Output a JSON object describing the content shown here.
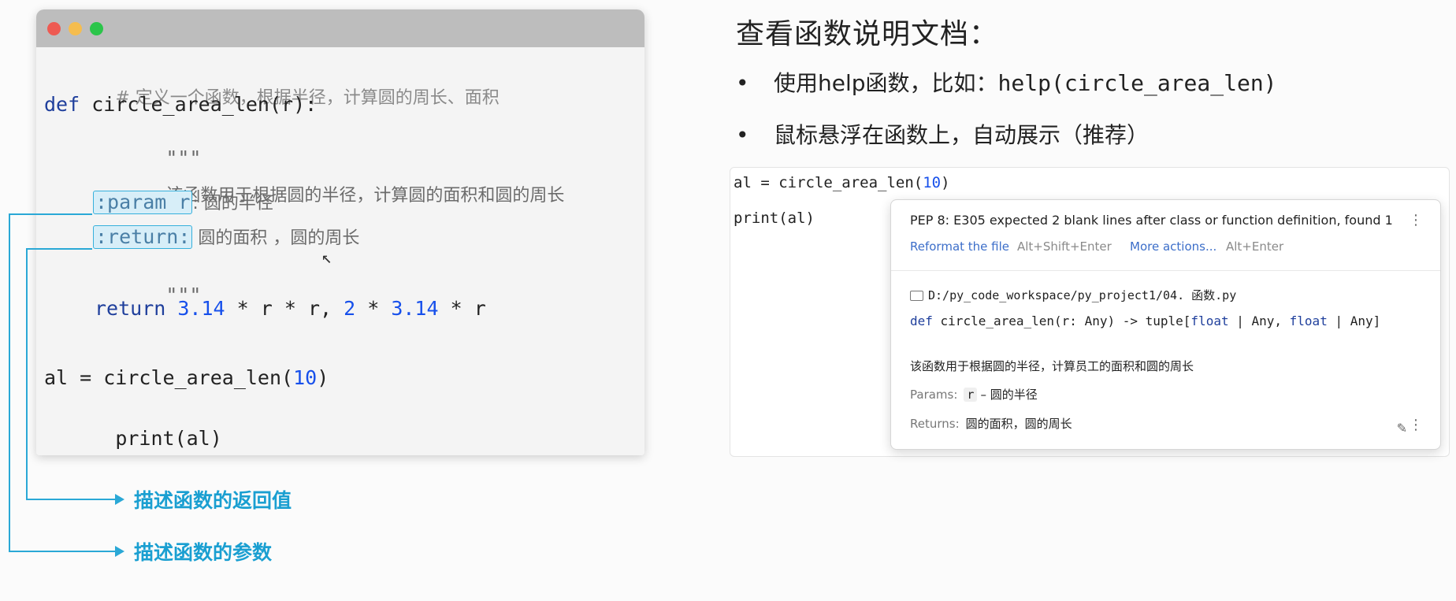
{
  "colors": {
    "mac_red": "#ee5a52",
    "mac_yellow": "#f5bd4f",
    "mac_green": "#2bc54a",
    "annotation": "#1a9fd1"
  },
  "editor": {
    "comment": "# 定义一个函数，根据半径，计算圆的周长、面积",
    "def_kw": "def",
    "def_sig": " circle_area_len(r):",
    "doc_open": "\"\"\"",
    "doc_desc": "该函数用于根据圆的半径，计算圆的面积和圆的周长",
    "param_tag": ":param r",
    "param_desc": ": 圆的半径",
    "return_tag": ":return:",
    "return_desc": " 圆的面积 ，圆的周长",
    "doc_close": "\"\"\"",
    "return_kw": "return",
    "ret_n1": "3.14",
    "ret_mid1": " * r * r, ",
    "ret_n2": "2",
    "ret_mid2": " * ",
    "ret_n3": "3.14",
    "ret_end": " * r",
    "call_prefix": "al = circle_area_len(",
    "call_arg": "10",
    "call_suffix": ")",
    "print_line": "print(al)"
  },
  "annotations": {
    "return_label": "描述函数的返回值",
    "param_label": "描述函数的参数"
  },
  "right": {
    "heading": "查看函数说明文档：",
    "bullet_mark": "•",
    "bullet1_text": "使用help函数，比如：",
    "bullet1_code": "help(circle_area_len)",
    "bullet2_text": "鼠标悬浮在函数上，自动展示（推荐）"
  },
  "ide": {
    "line1_prefix": "al = circle_area_len(",
    "line1_arg": "10",
    "line1_suffix": ")",
    "line2": "print(al)"
  },
  "popup": {
    "pep_message": "PEP 8: E305 expected 2 blank lines after class or function definition, found 1",
    "menu_glyph": "⋮",
    "reformat_link": "Reformat the file",
    "reformat_shortcut": "Alt+Shift+Enter",
    "more_actions_link": "More actions...",
    "more_actions_shortcut": "Alt+Enter",
    "file_path": "D:/py_code_workspace/py_project1/04. 函数.py",
    "sig_def": "def",
    "sig_name": " circle_area_len(r: Any) -> tuple[",
    "sig_float1": "float",
    "sig_mid1": " | Any, ",
    "sig_float2": "float",
    "sig_end": " | Any]",
    "description": "该函数用于根据圆的半径，计算员工的面积和圆的周长",
    "params_label": "Params:",
    "param_name": "r",
    "param_desc": "– 圆的半径",
    "returns_label": "Returns:",
    "returns_desc": "圆的面积，圆的周长",
    "edit_glyph": "✎"
  }
}
